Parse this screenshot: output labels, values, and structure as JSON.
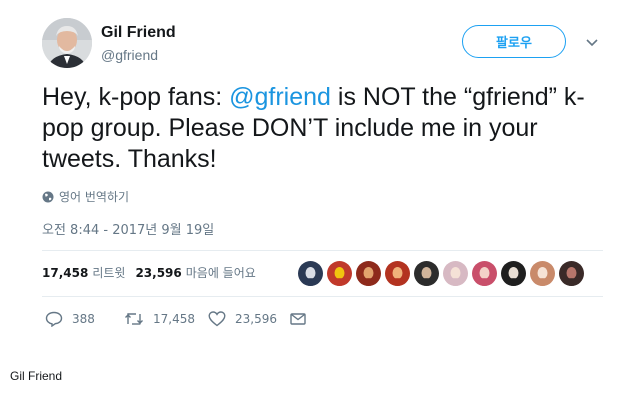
{
  "author": {
    "name": "Gil Friend",
    "handle": "@gfriend"
  },
  "follow_button": {
    "label": "팔로우"
  },
  "tweet": {
    "text_before": "Hey, k-pop fans: ",
    "mention": "@gfriend",
    "text_after": " is NOT the “gfriend” k-pop group. Please DON’T include me in your tweets. Thanks!"
  },
  "translate_label": "영어 번역하기",
  "timestamp": "오전 8:44 - 2017년 9월 19일",
  "stats": {
    "retweets_count": "17,458",
    "retweets_label": "리트윗",
    "likes_count": "23,596",
    "likes_label": "마음에 들어요"
  },
  "likers": [
    {
      "color": "#2b3a55",
      "accent": "#d9dde6"
    },
    {
      "color": "#c0392b",
      "accent": "#f1c40f"
    },
    {
      "color": "#8e2a1b",
      "accent": "#e3a36d"
    },
    {
      "color": "#b33320",
      "accent": "#f0b27a"
    },
    {
      "color": "#2c2c2c",
      "accent": "#d0b49a"
    },
    {
      "color": "#d7b9c3",
      "accent": "#f5e1d6"
    },
    {
      "color": "#c94f6a",
      "accent": "#f3d2c8"
    },
    {
      "color": "#1f1f1f",
      "accent": "#e8ded4"
    },
    {
      "color": "#c98a6a",
      "accent": "#f6e3d6"
    },
    {
      "color": "#3a2a28",
      "accent": "#b7766b"
    }
  ],
  "actions": {
    "replies": "388",
    "retweets": "17,458",
    "likes": "23,596"
  },
  "caption": "Gil Friend",
  "colors": {
    "accent": "#1da1f2",
    "mention": "#1b95e0",
    "secondary_text": "#657786",
    "divider": "#e6ecf0"
  }
}
